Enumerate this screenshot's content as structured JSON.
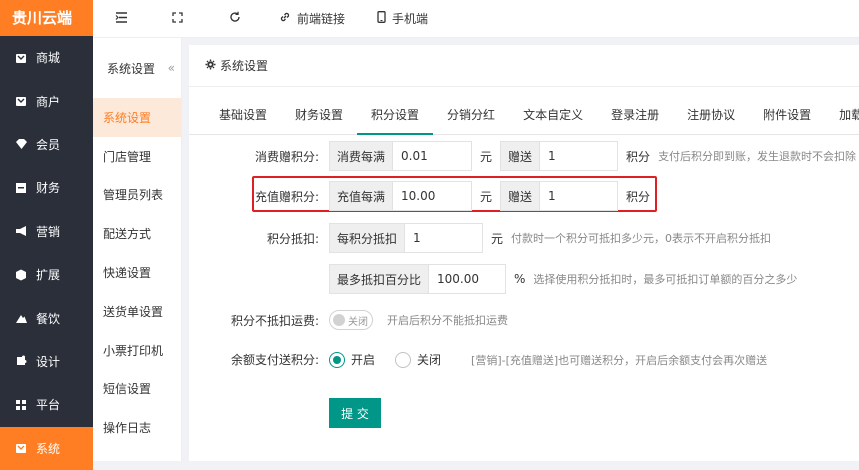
{
  "app": {
    "logo_text": "贵川云端",
    "brand_color": "#ff7d23",
    "accent_color": "#009688"
  },
  "sidebar": {
    "items": [
      {
        "label": "商城",
        "icon": "shop-icon"
      },
      {
        "label": "商户",
        "icon": "merchant-icon"
      },
      {
        "label": "会员",
        "icon": "member-icon"
      },
      {
        "label": "财务",
        "icon": "finance-icon"
      },
      {
        "label": "营销",
        "icon": "marketing-icon"
      },
      {
        "label": "扩展",
        "icon": "extension-icon"
      },
      {
        "label": "餐饮",
        "icon": "dining-icon"
      },
      {
        "label": "设计",
        "icon": "design-icon"
      },
      {
        "label": "平台",
        "icon": "platform-icon"
      },
      {
        "label": "系统",
        "icon": "system-icon"
      }
    ]
  },
  "topbar": {
    "frontend_link": "前端链接",
    "mobile": "手机端"
  },
  "subnav": {
    "title": "系统设置",
    "collapse": "«",
    "items": [
      "系统设置",
      "门店管理",
      "管理员列表",
      "配送方式",
      "快递设置",
      "送货单设置",
      "小票打印机",
      "短信设置",
      "操作日志"
    ]
  },
  "main": {
    "title": "系统设置",
    "tabs": [
      "基础设置",
      "财务设置",
      "积分设置",
      "分销分红",
      "文本自定义",
      "登录注册",
      "注册协议",
      "附件设置",
      "加载图标"
    ],
    "active_tab": "积分设置",
    "consume": {
      "label": "消费赠积分:",
      "addon1": "消费每满",
      "value1": "0.01",
      "unit1": "元",
      "addon2": "赠送",
      "value2": "1",
      "unit2": "积分",
      "hint": "支付后积分即到账，发生退款时不会扣除"
    },
    "recharge": {
      "label": "充值赠积分:",
      "addon1": "充值每满",
      "value1": "10.00",
      "unit1": "元",
      "addon2": "赠送",
      "value2": "1",
      "unit2": "积分"
    },
    "deduct": {
      "label": "积分抵扣:",
      "addon1": "每积分抵扣",
      "value1": "1",
      "unit1": "元",
      "hint1": "付款时一个积分可抵扣多少元，0表示不开启积分抵扣",
      "addon2": "最多抵扣百分比",
      "value2": "100.00",
      "unit2": "%",
      "hint2": "选择使用积分抵扣时，最多可抵扣订单额的百分之多少"
    },
    "freight": {
      "label": "积分不抵扣运费:",
      "switch_text": "关闭",
      "hint": "开启后积分不能抵扣运费"
    },
    "balance": {
      "label": "余额支付送积分:",
      "opt_on": "开启",
      "opt_off": "关闭",
      "hint": "[营销]-[充值赠送]也可赠送积分，开启后余额支付会再次赠送"
    },
    "submit": "提 交"
  }
}
